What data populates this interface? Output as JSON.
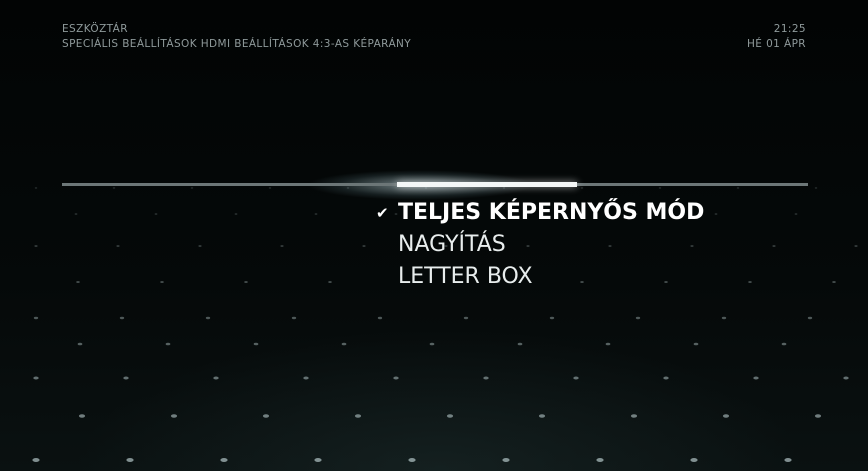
{
  "header": {
    "title": "ESZKÖZTÁR",
    "breadcrumb": "SPECIÁLIS BEÁLLÍTÁSOK HDMI BEÁLLÍTÁSOK 4:3-AS KÉPARÁNY",
    "time": "21:25",
    "date": "HÉ 01 ÁPR"
  },
  "menu": {
    "items": [
      {
        "label": "TELJES KÉPERNYŐS MÓD",
        "selected": true
      },
      {
        "label": "NAGYÍTÁS",
        "selected": false
      },
      {
        "label": "LETTER BOX",
        "selected": false
      }
    ]
  },
  "icons": {
    "selected_marker": "checkmark-icon"
  },
  "colors": {
    "background": "#030606",
    "header_text": "#8f9a9b",
    "menu_text": "#e8eded",
    "accent": "#ffffff"
  }
}
